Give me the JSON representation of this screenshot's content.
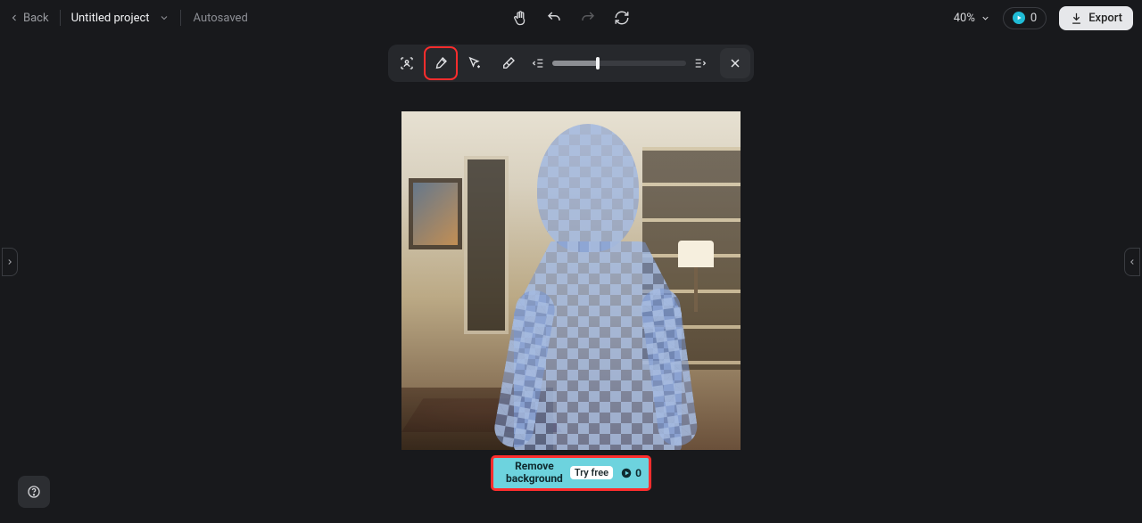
{
  "topbar": {
    "back_label": "Back",
    "project_name": "Untitled project",
    "autosaved_label": "Autosaved",
    "zoom_label": "40%",
    "credits_value": "0",
    "export_label": "Export"
  },
  "toolbar": {
    "tools": [
      {
        "name": "auto-select",
        "icon": "person-focus-icon",
        "active": false,
        "highlighted": false
      },
      {
        "name": "brush",
        "icon": "brush-icon",
        "active": true,
        "highlighted": true
      },
      {
        "name": "magic-select",
        "icon": "cursor-sparkle-icon",
        "active": false,
        "highlighted": false
      },
      {
        "name": "eraser",
        "icon": "eraser-icon",
        "active": false,
        "highlighted": false
      }
    ],
    "slider_left_icon": "dedent-icon",
    "slider_right_icon": "indent-icon",
    "slider_value_pct": 34,
    "close_icon": "close-icon"
  },
  "remove_bg": {
    "line1": "Remove",
    "line2": "background",
    "try_label": "Try free",
    "cost_value": "0"
  },
  "help_icon": "help-icon"
}
